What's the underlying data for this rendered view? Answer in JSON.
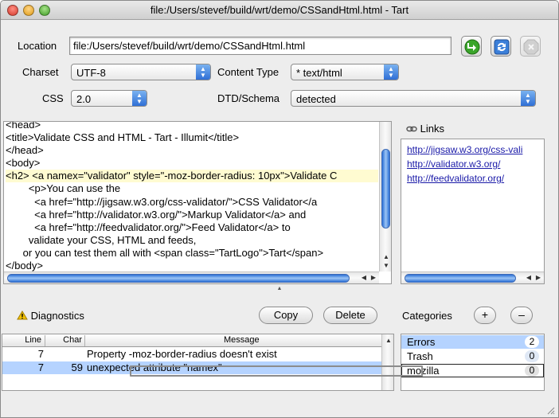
{
  "window": {
    "title": "file:/Users/stevef/build/wrt/demo/CSSandHtml.html - Tart"
  },
  "location": {
    "label": "Location",
    "value": "file:/Users/stevef/build/wrt/demo/CSSandHtml.html"
  },
  "charset": {
    "label": "Charset",
    "value": "UTF-8"
  },
  "content_type": {
    "label": "Content Type",
    "value": "* text/html"
  },
  "css": {
    "label": "CSS",
    "value": "2.0"
  },
  "dtd": {
    "label": "DTD/Schema",
    "value": "detected"
  },
  "toolbar_icons": [
    "go-arrow-icon",
    "refresh-icon",
    "stop-icon"
  ],
  "editor": {
    "lines": [
      "<head>",
      "<title>Validate CSS and HTML - Tart - Illumit</title>",
      "</head>",
      "<body>",
      "<h2> <a namex=\"validator\" style=\"-moz-border-radius: 10px\">Validate C",
      "        <p>You can use the",
      "          <a href=\"http://jigsaw.w3.org/css-validator/\">CSS Validator</a",
      "          <a href=\"http://validator.w3.org/\">Markup Validator</a> and",
      "          <a href=\"http://feedvalidator.org/\">Feed Validator</a> to",
      "        validate your CSS, HTML and feeds,",
      "      or you can test them all with <span class=\"TartLogo\">Tart</span>",
      "</body>"
    ],
    "highlighted_line": 4
  },
  "links": {
    "label": "Links",
    "items": [
      "http://jigsaw.w3.org/css-vali",
      "http://validator.w3.org/",
      "http://feedvalidator.org/"
    ]
  },
  "diagnostics": {
    "label": "Diagnostics",
    "copy_label": "Copy",
    "delete_label": "Delete",
    "columns": [
      "Line",
      "Char",
      "Message"
    ],
    "rows": [
      {
        "line": "7",
        "char": "",
        "message": "Property -moz-border-radius doesn't exist"
      },
      {
        "line": "7",
        "char": "59",
        "message": "unexpected attribute \"namex\""
      }
    ],
    "selected_row": 1
  },
  "categories": {
    "label": "Categories",
    "add_label": "+",
    "remove_label": "–",
    "items": [
      {
        "name": "Errors",
        "count": "2"
      },
      {
        "name": "Trash",
        "count": "0"
      },
      {
        "name": "mozilla",
        "count": "0"
      }
    ]
  },
  "colors": {
    "selection": "#b5d3ff",
    "link": "#1a1aa8",
    "aqua_blue": "#2f6fd6",
    "go_green": "#3aa52a"
  }
}
